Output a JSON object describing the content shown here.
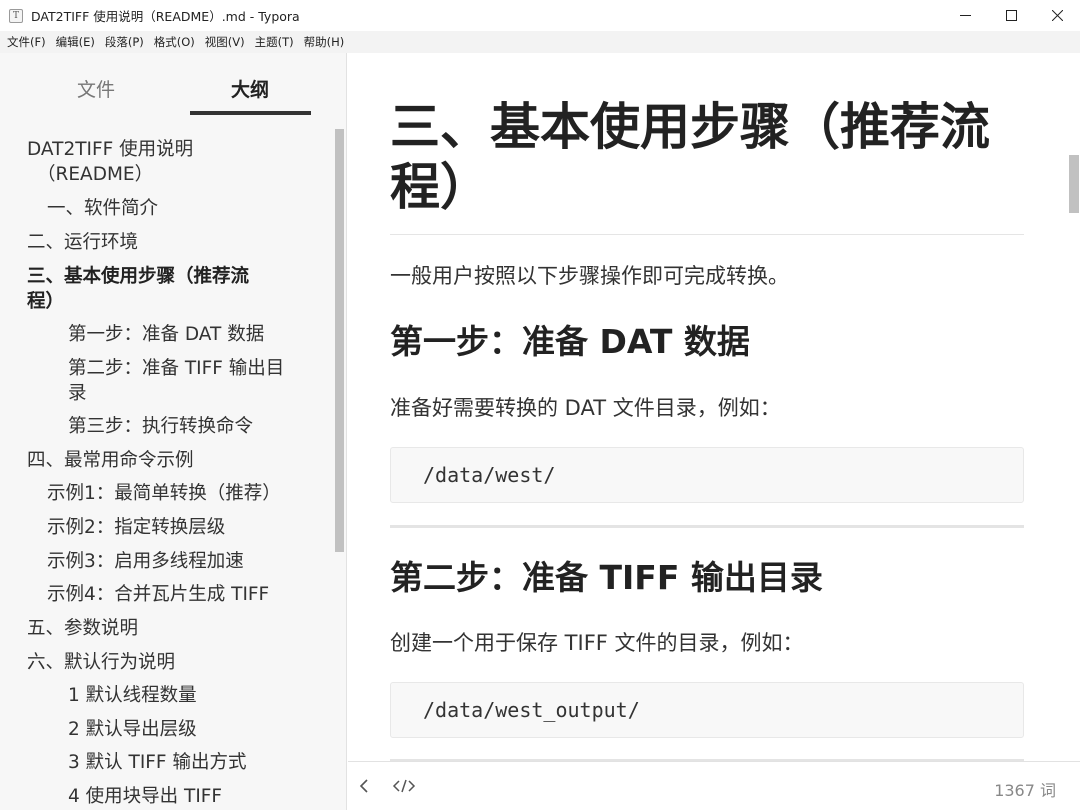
{
  "window": {
    "title": "DAT2TIFF 使用说明（README）.md - Typora",
    "app_icon_letter": "T"
  },
  "menu": [
    "文件(F)",
    "编辑(E)",
    "段落(P)",
    "格式(O)",
    "视图(V)",
    "主题(T)",
    "帮助(H)"
  ],
  "sidebar": {
    "tabs": {
      "files": "文件",
      "outline": "大纲",
      "active": "outline"
    },
    "outline": [
      {
        "text": "DAT2TIFF 使用说明",
        "level": 1
      },
      {
        "text": "（README）",
        "level": 1
      },
      {
        "text": "一、软件简介",
        "level": 2
      },
      {
        "text": "二、运行环境",
        "level": 1
      },
      {
        "text": "三、基本使用步骤（推荐流",
        "level": 1,
        "active": true
      },
      {
        "text": "程）",
        "level": 1,
        "active": true
      },
      {
        "text": "第一步：准备 DAT 数据",
        "level": 3
      },
      {
        "text": "第二步：准备 TIFF 输出目",
        "level": 3
      },
      {
        "text": "录",
        "level": 3
      },
      {
        "text": "第三步：执行转换命令",
        "level": 3
      },
      {
        "text": "四、最常用命令示例",
        "level": 1
      },
      {
        "text": "示例1：最简单转换（推荐）",
        "level": 2
      },
      {
        "text": "示例2：指定转换层级",
        "level": 2
      },
      {
        "text": "示例3：启用多线程加速",
        "level": 2
      },
      {
        "text": "示例4：合并瓦片生成 TIFF",
        "level": 2
      },
      {
        "text": "五、参数说明",
        "level": 1
      },
      {
        "text": "六、默认行为说明",
        "level": 1
      },
      {
        "text": "1 默认线程数量",
        "level": 3
      },
      {
        "text": "2 默认导出层级",
        "level": 3
      },
      {
        "text": "3 默认 TIFF 输出方式",
        "level": 3
      },
      {
        "text": "4 使用块导出 TIFF",
        "level": 3
      }
    ]
  },
  "doc": {
    "h1_line1": "三、基本使用步骤（推荐流",
    "h1_line2": "程）",
    "intro": "一般用户按照以下步骤操作即可完成转换。",
    "step1_title": "第一步：准备 DAT 数据",
    "step1_text": "准备好需要转换的 DAT 文件目录，例如：",
    "step1_code": "/data/west/",
    "step2_title": "第二步：准备 TIFF 输出目录",
    "step2_text": "创建一个用于保存 TIFF 文件的目录，例如：",
    "step2_code": "/data/west_output/"
  },
  "status": {
    "word_count": "1367 词"
  }
}
